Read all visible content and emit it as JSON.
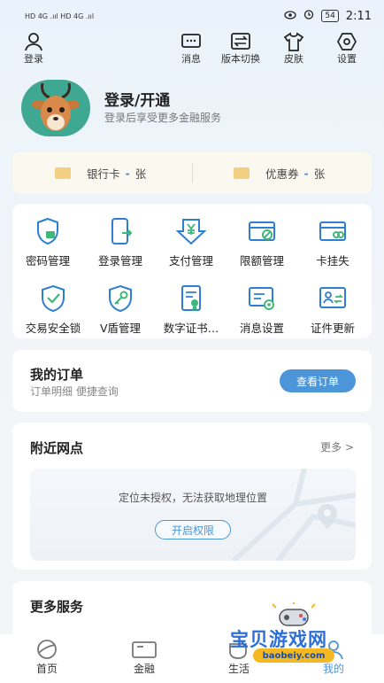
{
  "status_bar": {
    "left": "HD 4G .ııl HD 4G .ııl",
    "battery": "54",
    "time": "2:11"
  },
  "top_nav": {
    "login": "登录",
    "message": "消息",
    "version_switch": "版本切换",
    "skin": "皮肤",
    "settings": "设置"
  },
  "profile": {
    "title": "登录/开通",
    "subtitle": "登录后享受更多金融服务"
  },
  "cards": {
    "bank_card_label": "银行卡",
    "bank_card_unit": "张",
    "coupon_label": "优惠券",
    "coupon_unit": "张",
    "count_placeholder": "-"
  },
  "services": [
    {
      "label": "密码管理",
      "icon": "password-shield-icon"
    },
    {
      "label": "登录管理",
      "icon": "phone-login-icon"
    },
    {
      "label": "支付管理",
      "icon": "yuan-payment-icon"
    },
    {
      "label": "限额管理",
      "icon": "card-limit-icon"
    },
    {
      "label": "卡挂失",
      "icon": "card-lost-icon"
    },
    {
      "label": "交易安全锁",
      "icon": "check-shield-icon"
    },
    {
      "label": "V盾管理",
      "icon": "key-shield-icon"
    },
    {
      "label": "数字证书…",
      "icon": "certificate-icon"
    },
    {
      "label": "消息设置",
      "icon": "message-settings-icon"
    },
    {
      "label": "证件更新",
      "icon": "id-update-icon"
    }
  ],
  "orders": {
    "title": "我的订单",
    "subtitle": "订单明细 便捷查询",
    "button": "查看订单"
  },
  "nearby": {
    "title": "附近网点",
    "more": "更多 >",
    "message": "定位未授权，无法获取地理位置",
    "button": "开启权限"
  },
  "more_services": {
    "title": "更多服务"
  },
  "tabs": {
    "home": "首页",
    "finance": "金融",
    "life": "生活",
    "me": "我的"
  },
  "watermark": {
    "text": "宝贝游戏网",
    "url": "baobeiy.com"
  },
  "colors": {
    "accent": "#4b95d8",
    "icon_blue": "#2f7fd0",
    "icon_green": "#3eb87a",
    "card_strip": "#fbf9ef"
  }
}
